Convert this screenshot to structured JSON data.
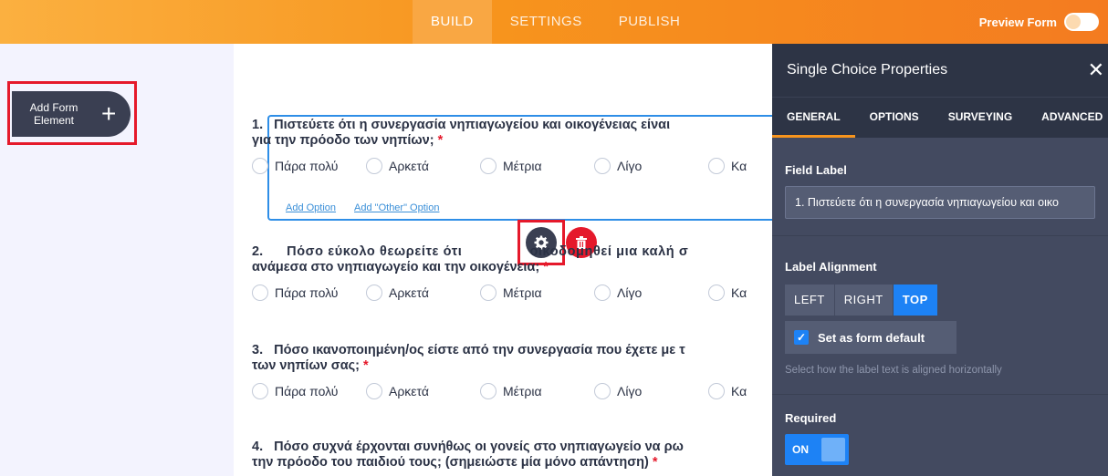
{
  "topbar": {
    "tabs": [
      {
        "label": "BUILD"
      },
      {
        "label": "SETTINGS"
      },
      {
        "label": "PUBLISH"
      }
    ],
    "preview_label": "Preview Form"
  },
  "left": {
    "add_element_label": "Add Form Element",
    "add_icon": "plus-icon"
  },
  "form": {
    "questions": [
      {
        "number": "1.",
        "line1": "Πιστεύετε ότι η συνεργασία νηπιαγωγείου και οικογένειας είναι",
        "line2": "για την πρόοδο των νηπίων;",
        "required_mark": "*"
      },
      {
        "number": "2.",
        "line1": "Πόσο εύκολο θεωρείτε ότι",
        "line1b": "οικοδομηθεί μια καλή σ",
        "line2": "ανάμεσα στο νηπιαγωγείο και την οικογένεια;",
        "required_mark": "*"
      },
      {
        "number": "3.",
        "line1": "Πόσο ικανοποιημένη/ος είστε από την συνεργασία που έχετε με τ",
        "line2": "των νηπίων σας;",
        "required_mark": "*"
      },
      {
        "number": "4.",
        "line1": "Πόσο συχνά έρχονται συνήθως οι γονείς στο νηπιαγωγείο να ρω",
        "line2": "την πρόοδο του παιδιού τους; (σημειώστε μία μόνο απάντηση)",
        "required_mark": "*"
      }
    ],
    "options": [
      "Πάρα πολύ",
      "Αρκετά",
      "Μέτρια",
      "Λίγο",
      "Κα"
    ],
    "add_option": "Add Option",
    "add_other_option": "Add \"Other\" Option"
  },
  "panel": {
    "title": "Single Choice Properties",
    "close_icon": "close-icon",
    "tabs": [
      {
        "label": "GENERAL"
      },
      {
        "label": "OPTIONS"
      },
      {
        "label": "SURVEYING"
      },
      {
        "label": "ADVANCED"
      }
    ],
    "field_label_title": "Field Label",
    "field_label_value": "1.  Πιστεύετε ότι η συνεργασία νηπιαγωγείου και οικο",
    "label_alignment_title": "Label Alignment",
    "alignments": [
      {
        "label": "LEFT"
      },
      {
        "label": "RIGHT"
      },
      {
        "label": "TOP"
      }
    ],
    "set_default_label": "Set as form default",
    "alignment_hint": "Select how the label text is aligned horizontally",
    "required_title": "Required",
    "required_state": "ON"
  },
  "colors": {
    "accent_orange": "#f7941d",
    "selected_blue": "#2e8ee7",
    "required_red": "#e5192b",
    "delete_red": "#e5192b",
    "settings_dark": "#3a3f52"
  }
}
